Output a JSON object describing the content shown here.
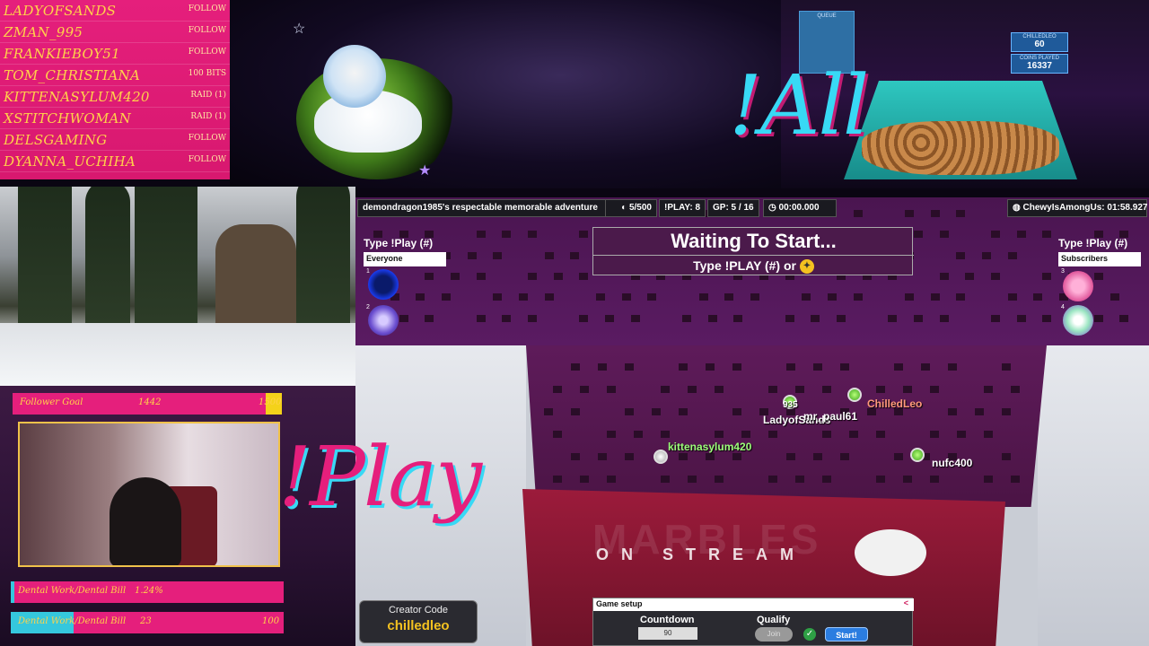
{
  "events": [
    {
      "name": "LADYOFSANDS",
      "action": "FOLLOW"
    },
    {
      "name": "ZMAN_995",
      "action": "FOLLOW"
    },
    {
      "name": "FRANKIEBOY51",
      "action": "FOLLOW"
    },
    {
      "name": "TOM_CHRISTIANA",
      "action": "100 BITS"
    },
    {
      "name": "KITTENASYLUM420",
      "action": "RAID (1)"
    },
    {
      "name": "XSTITCHWOMAN",
      "action": "RAID (1)"
    },
    {
      "name": "DELSGAMING",
      "action": "FOLLOW"
    },
    {
      "name": "DYANNA_UCHIHA",
      "action": "FOLLOW"
    }
  ],
  "overlay_text": {
    "all": "!All",
    "play": "!Play"
  },
  "pusher": {
    "queue_label": "QUEUE",
    "player_label": "CHILLEDLEO",
    "player_value": "60",
    "coins_label": "COINS PLAYED",
    "coins_value": "16337"
  },
  "goals": {
    "follower": {
      "label": "Follower Goal",
      "current": "1442",
      "target": "1500",
      "progress": 0.96
    },
    "bill1": {
      "label": "Dental Work/Dental Bill",
      "current": "1.24%",
      "progress": 0.0124
    },
    "bill2": {
      "label": "Dental Work/Dental Bill",
      "current": "23",
      "target": "100",
      "progress": 0.23
    }
  },
  "hud": {
    "adventure": "demondragon1985's respectable memorable adventure",
    "marbles": "5/500",
    "play_count": "!PLAY: 8",
    "gp": "GP: 5 / 16",
    "timer": "00:00.000",
    "record": "ChewyIsAmongUs: 01:58.927"
  },
  "status": {
    "title": "Waiting To Start...",
    "subtitle": "Type !PLAY (#) or"
  },
  "slots": {
    "left": {
      "title": "Type !Play (#)",
      "label": "Everyone",
      "items": [
        "1",
        "2"
      ]
    },
    "right": {
      "title": "Type !Play (#)",
      "label": "Subscribers",
      "items": [
        "3",
        "4"
      ]
    }
  },
  "players": [
    {
      "name": "ChilledLeo",
      "color": "#ff9a7a"
    },
    {
      "name": "LadyofSands",
      "color": "#ffffff"
    },
    {
      "name": "mr_paul61",
      "color": "#ffffff"
    },
    {
      "name": "935",
      "color": "#ffffff"
    },
    {
      "name": "kittenasylum420",
      "color": "#9cff7a"
    },
    {
      "name": "nufc400",
      "color": "#ffffff"
    }
  ],
  "brand": {
    "big": "MARBLES",
    "small": "ON STREAM"
  },
  "creator": {
    "label": "Creator Code",
    "code": "chilledleo"
  },
  "setup": {
    "title": "Game setup",
    "close": "<",
    "countdown_label": "Countdown",
    "countdown_value": "90",
    "qualify_label": "Qualify",
    "join_label": "Join",
    "start_label": "Start!"
  },
  "colors": {
    "pink": "#e51f7c",
    "cyan": "#38d9f5",
    "gold": "#ffd24a"
  }
}
